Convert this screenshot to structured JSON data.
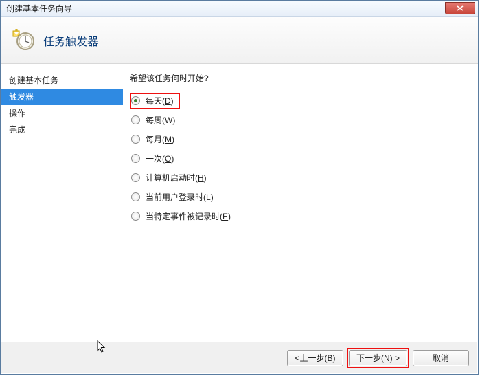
{
  "window": {
    "title": "创建基本任务向导"
  },
  "header": {
    "title": "任务触发器"
  },
  "sidebar": {
    "items": [
      {
        "label": "创建基本任务"
      },
      {
        "label": "触发器"
      },
      {
        "label": "操作"
      },
      {
        "label": "完成"
      }
    ]
  },
  "content": {
    "prompt": "希望该任务何时开始?",
    "options": [
      {
        "label": "每天",
        "accel": "D",
        "checked": true
      },
      {
        "label": "每周",
        "accel": "W",
        "checked": false
      },
      {
        "label": "每月",
        "accel": "M",
        "checked": false
      },
      {
        "label": "一次",
        "accel": "O",
        "checked": false
      },
      {
        "label": "计算机启动时",
        "accel": "H",
        "checked": false
      },
      {
        "label": "当前用户登录时",
        "accel": "L",
        "checked": false
      },
      {
        "label": "当特定事件被记录时",
        "accel": "E",
        "checked": false
      }
    ]
  },
  "footer": {
    "back": "<上一步(B)",
    "next": "下一步(N) >",
    "cancel": "取消"
  }
}
